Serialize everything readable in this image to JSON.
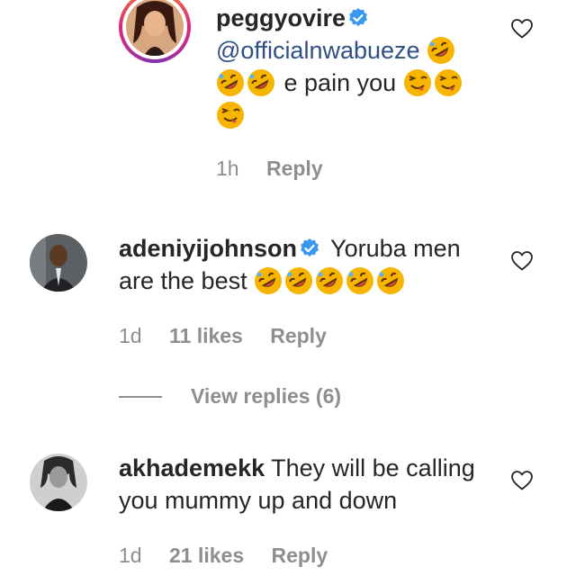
{
  "comments": [
    {
      "username": "peggyovire",
      "verified": true,
      "mention": "@officialnwabueze",
      "text": "e pain you",
      "time": "1h",
      "likes": "",
      "reply_label": "Reply",
      "has_story_ring": true
    },
    {
      "username": "adeniyijohnson",
      "verified": true,
      "text_line1": "Yoruba men",
      "text_line2": "are the best",
      "time": "1d",
      "likes": "11 likes",
      "reply_label": "Reply"
    },
    {
      "username": "akhademekk",
      "verified": false,
      "text_line1": "They will be calling",
      "text_line2": "you mummy up and down",
      "time": "1d",
      "likes": "21 likes",
      "reply_label": "Reply"
    }
  ],
  "view_replies_label": "View replies (6)",
  "colors": {
    "text": "#262626",
    "muted": "#8e8e8e",
    "mention": "#2f4f86",
    "verified": "#3897f0",
    "emoji": "#f7b500"
  },
  "icons": {
    "like": "heart-outline-icon",
    "verified": "verified-badge-icon",
    "laugh": "rolling-on-floor-laughing-emoji",
    "wink": "winking-tongue-emoji"
  }
}
